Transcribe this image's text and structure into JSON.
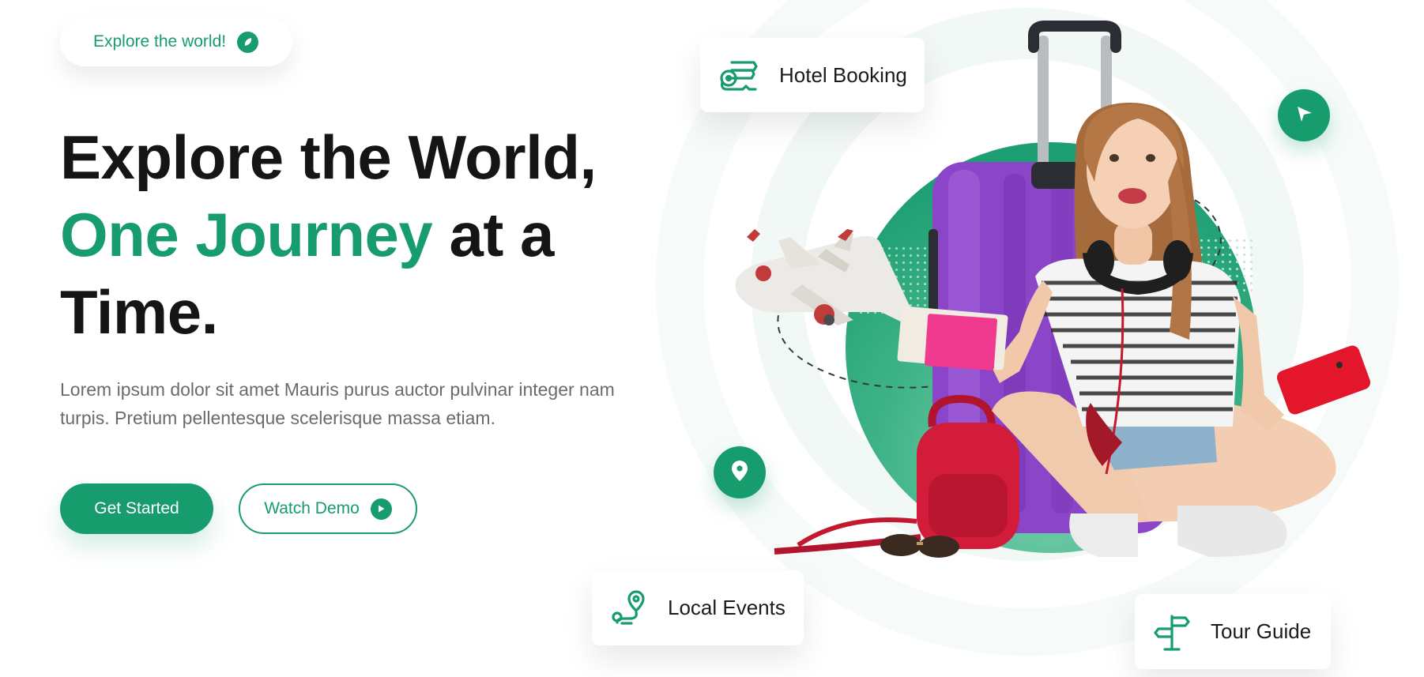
{
  "badge": {
    "label": "Explore the world!",
    "icon": "leaf-icon"
  },
  "headline": {
    "line1": "Explore the World,",
    "line2_accent": "One Journey",
    "line2_rest": " at a",
    "line3": "Time."
  },
  "description": "Lorem ipsum dolor sit amet Mauris purus auctor pulvinar integer nam turpis. Pretium pellentesque scelerisque massa etiam.",
  "buttons": {
    "primary": "Get Started",
    "secondary": "Watch Demo",
    "secondary_icon": "play-icon"
  },
  "cards": {
    "hotel": {
      "label": "Hotel Booking",
      "icon": "hotel-key-icon"
    },
    "events": {
      "label": "Local Events",
      "icon": "route-pin-icon"
    },
    "tour": {
      "label": "Tour Guide",
      "icon": "signpost-icon"
    }
  },
  "floating_buttons": [
    {
      "name": "navigation-button",
      "icon": "navigation-arrow-icon"
    },
    {
      "name": "location-button",
      "icon": "map-pin-icon"
    }
  ],
  "colors": {
    "accent": "#179c6e",
    "text_dark": "#151515",
    "text_muted": "#6b6b6b",
    "suitcase": "#8b45c9",
    "backpack": "#d31c3a",
    "phone": "#e3162b",
    "passport": "#ef3a8f"
  }
}
